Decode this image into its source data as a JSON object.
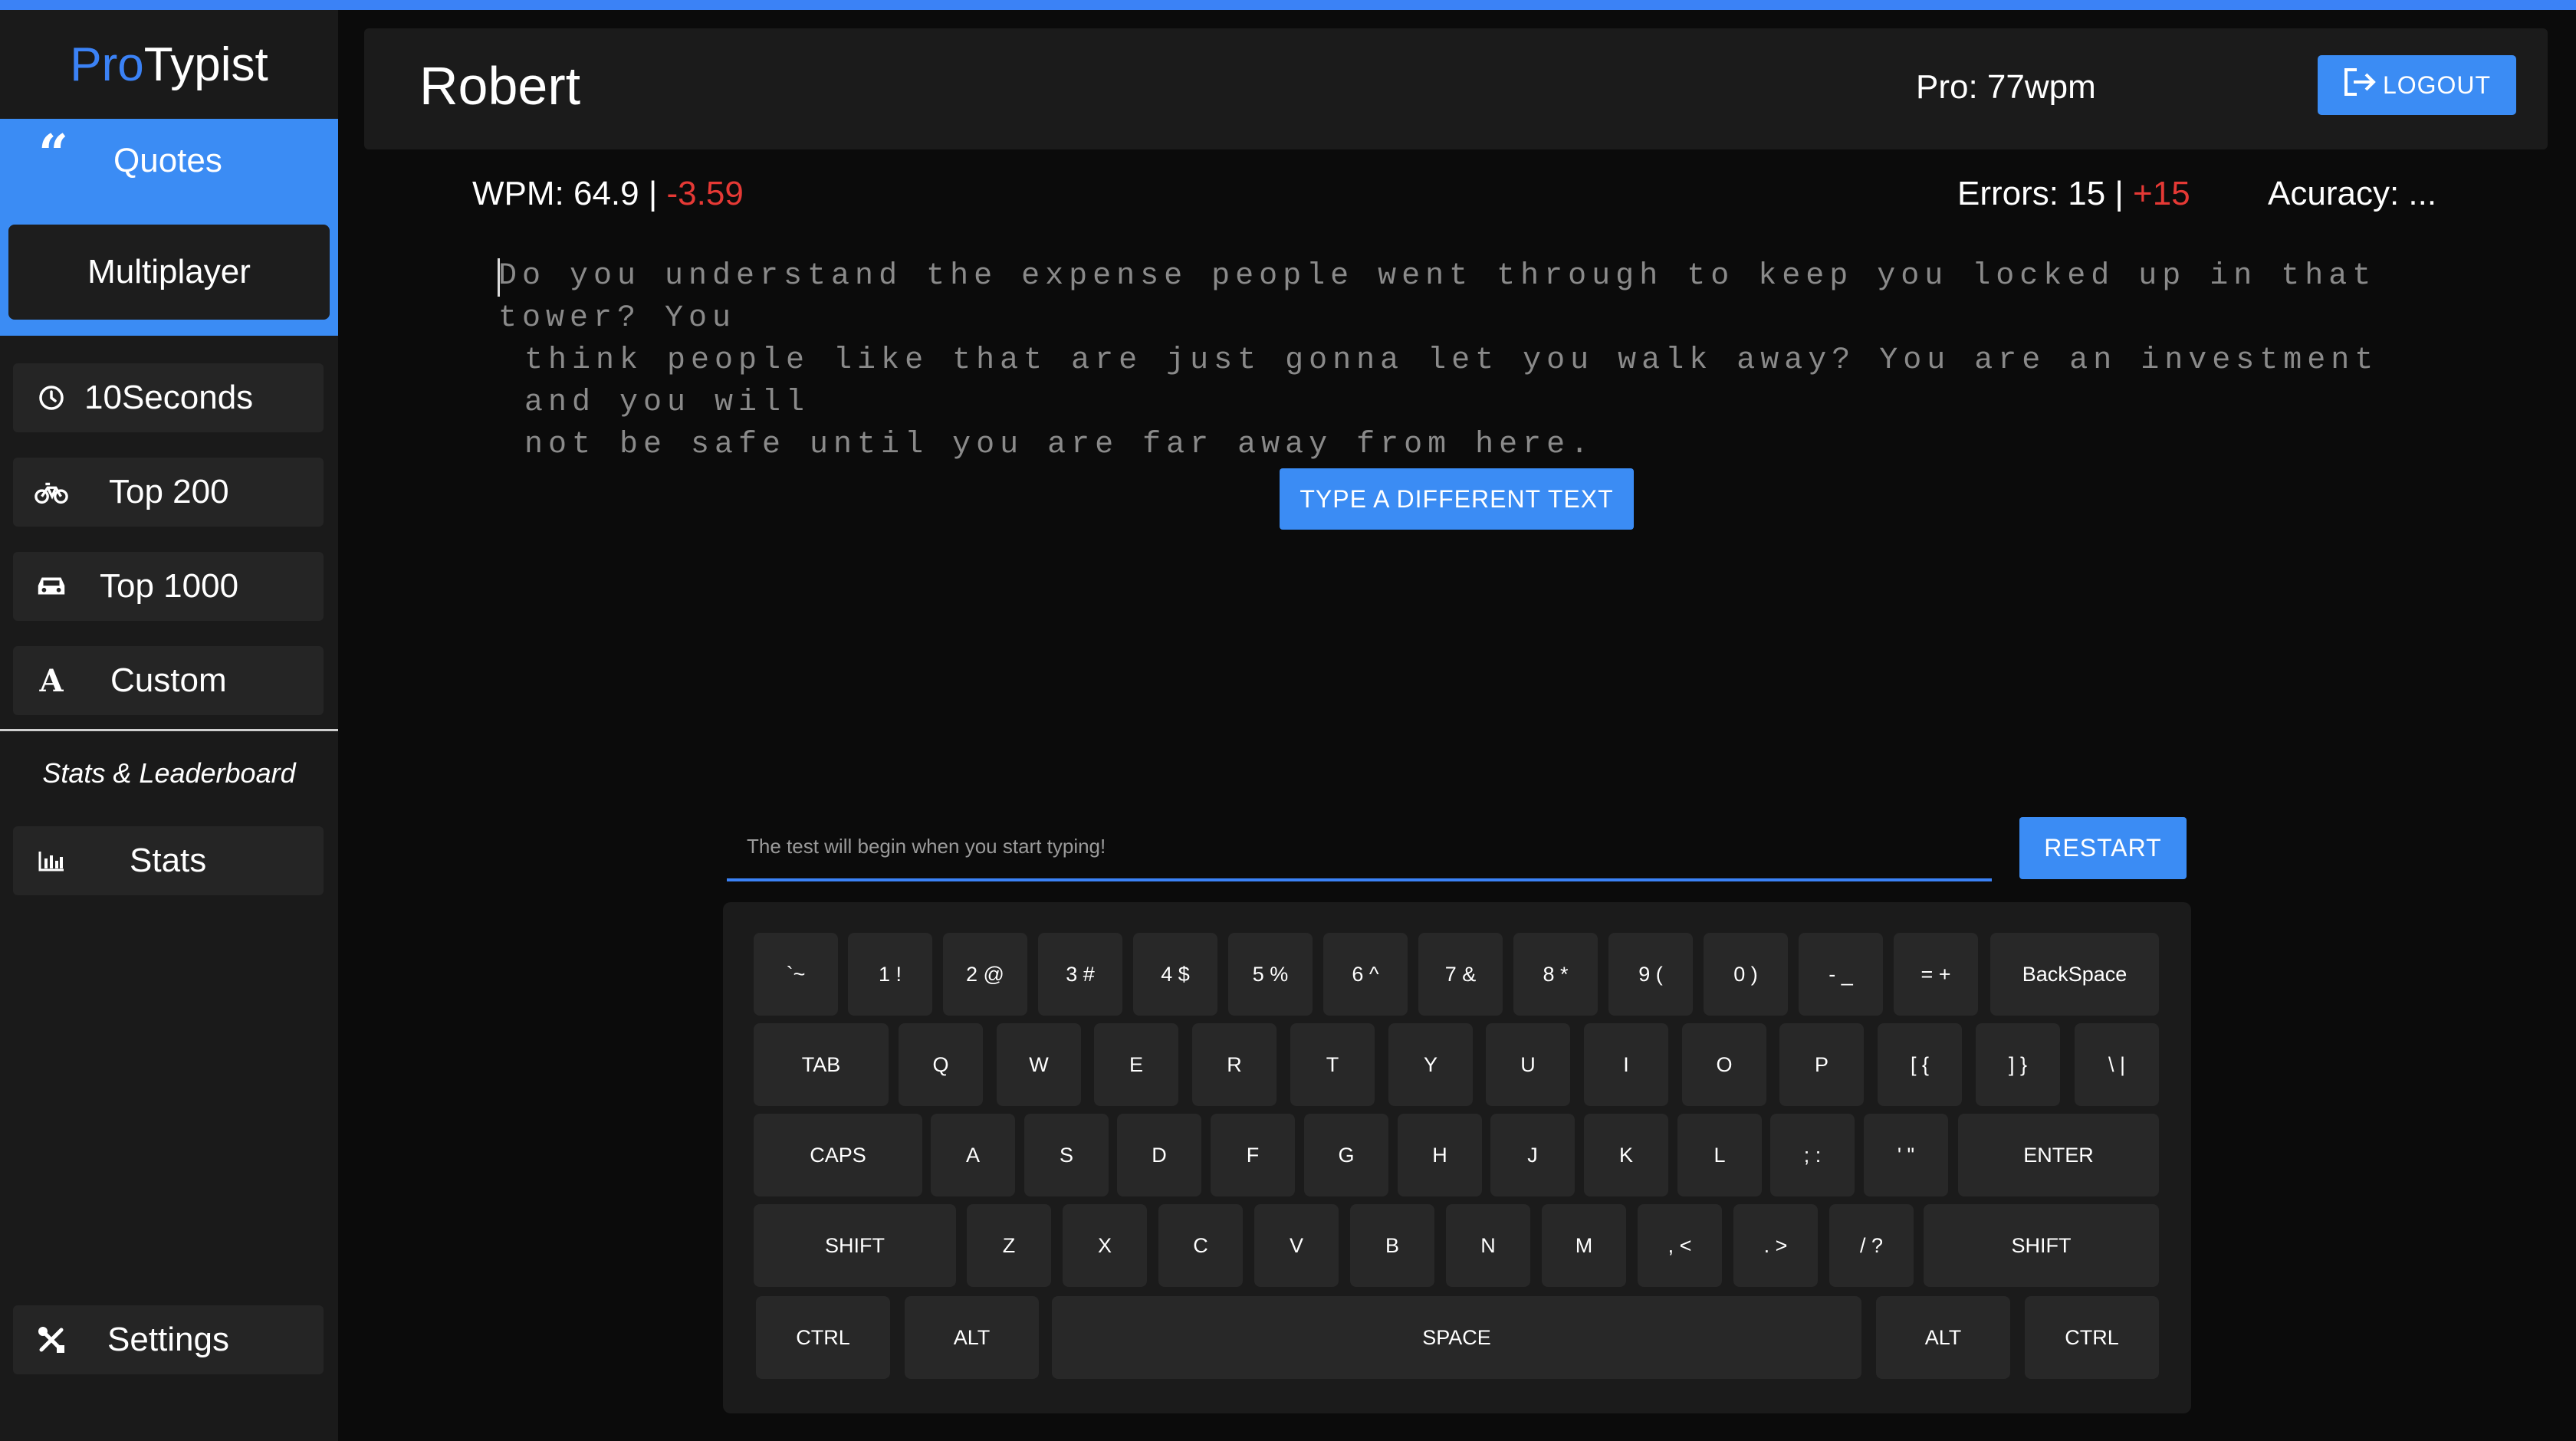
{
  "app": {
    "brand_pro": "Pro",
    "brand_typist": "Typist",
    "accent_color": "#3b82f6"
  },
  "sidebar": {
    "quotes": {
      "label": "Quotes",
      "icon": "quote-icon"
    },
    "multiplayer": {
      "label": "Multiplayer"
    },
    "modes": [
      {
        "label": "10Seconds",
        "icon": "clock-icon"
      },
      {
        "label": "Top 200",
        "icon": "bicycle-icon"
      },
      {
        "label": "Top 1000",
        "icon": "car-icon"
      },
      {
        "label": "Custom",
        "icon": "letter-a-icon"
      }
    ],
    "stats_heading": "Stats & Leaderboard",
    "stats": {
      "label": "Stats",
      "icon": "bar-chart-icon"
    },
    "settings": {
      "label": "Settings",
      "icon": "tools-icon"
    }
  },
  "header": {
    "username": "Robert",
    "pro_wpm": "Pro: 77wpm",
    "logout_label": "LOGOUT"
  },
  "stats": {
    "wpm_label": "WPM: 64.9 | ",
    "wpm_delta": "-3.59",
    "errors_label": "Errors: 15 | ",
    "errors_delta": "+15",
    "accuracy_label": "Acuracy: ..."
  },
  "passage": {
    "line1": "Do you understand the expense people went through to keep you locked up in that tower? You",
    "line2": "think people like that are just gonna let you walk away? You are an investment and you will",
    "line3": "not be safe until you are far away from here."
  },
  "actions": {
    "different_text": "TYPE A DIFFERENT TEXT",
    "restart": "RESTART"
  },
  "input": {
    "placeholder": "The test will begin when you start typing!",
    "value": ""
  },
  "keyboard": {
    "rows": [
      [
        "`~",
        "1 !",
        "2 @",
        "3 #",
        "4 $",
        "5 %",
        "6 ^",
        "7 &",
        "8 *",
        "9 (",
        "0 )",
        "- _",
        "= +",
        "BackSpace"
      ],
      [
        "TAB",
        "Q",
        "W",
        "E",
        "R",
        "T",
        "Y",
        "U",
        "I",
        "O",
        "P",
        "[ {",
        "] }",
        "\\ |"
      ],
      [
        "CAPS",
        "A",
        "S",
        "D",
        "F",
        "G",
        "H",
        "J",
        "K",
        "L",
        "; :",
        "' \"",
        "ENTER"
      ],
      [
        "SHIFT",
        "Z",
        "X",
        "C",
        "V",
        "B",
        "N",
        "M",
        ", <",
        ". >",
        "/ ?",
        "SHIFT"
      ],
      [
        "CTRL",
        "ALT",
        "SPACE",
        "ALT",
        "CTRL"
      ]
    ]
  }
}
